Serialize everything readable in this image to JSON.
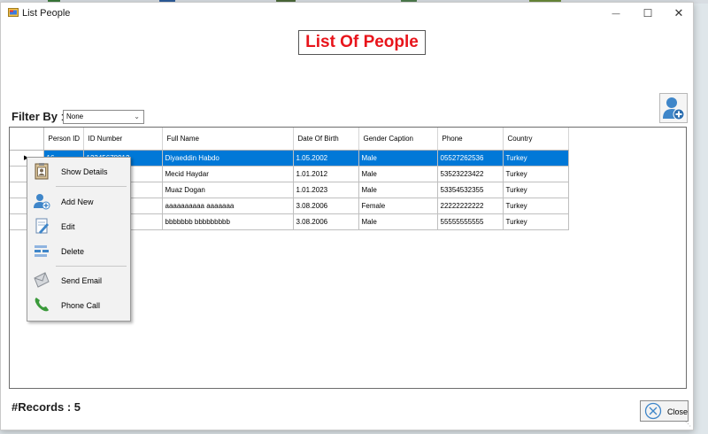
{
  "window": {
    "title": "List People",
    "minimize_glyph": "—",
    "maximize_glyph": "☐",
    "close_glyph": "✕"
  },
  "header": {
    "title": "List Of People"
  },
  "filter": {
    "label": "Filter By",
    "colon": " :",
    "selected": "None"
  },
  "grid": {
    "columns": [
      "Person ID",
      "ID Number",
      "Full Name",
      "Date Of Birth",
      "Gender Caption",
      "Phone",
      "Country"
    ],
    "rows": [
      [
        "16",
        "12345678912",
        "Diyaeddin Habdo",
        "1.05.2002",
        "Male",
        "05527262536",
        "Turkey"
      ],
      [
        "",
        "",
        "Mecid Haydar",
        "1.01.2012",
        "Male",
        "53523223422",
        "Turkey"
      ],
      [
        "",
        "",
        "Muaz Dogan",
        "1.01.2023",
        "Male",
        "53354532355",
        "Turkey"
      ],
      [
        "",
        "",
        "aaaaaaaaaa aaaaaaa",
        "3.08.2006",
        "Female",
        "22222222222",
        "Turkey"
      ],
      [
        "",
        "",
        "bbbbbbb bbbbbbbbb",
        "3.08.2006",
        "Male",
        "55555555555",
        "Turkey"
      ]
    ],
    "selected_row": 0,
    "selection_color": "#0078d7"
  },
  "context_menu": {
    "items": [
      {
        "label": "Show Details",
        "icon": "contact-card-icon"
      },
      {
        "label": "Add New",
        "icon": "add-person-icon"
      },
      {
        "label": "Edit",
        "icon": "edit-document-icon"
      },
      {
        "label": "Delete",
        "icon": "delete-rows-icon"
      },
      {
        "label": "Send Email",
        "icon": "email-icon"
      },
      {
        "label": "Phone Call",
        "icon": "phone-icon"
      }
    ]
  },
  "footer": {
    "records_label": "#Records : 5",
    "close_label": "Close"
  },
  "colors": {
    "heading_text": "#e8141b",
    "selection": "#0078d7"
  }
}
